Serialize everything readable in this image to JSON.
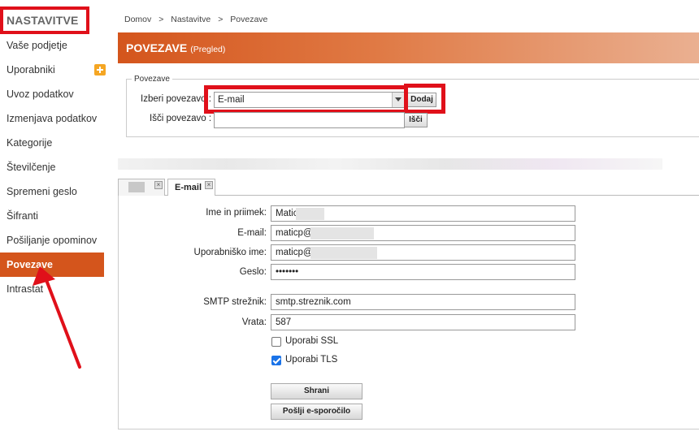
{
  "sidebar": {
    "title": "NASTAVITVE",
    "items": [
      {
        "label": "Vaše podjetje"
      },
      {
        "label": "Uporabniki"
      },
      {
        "label": "Uvoz podatkov"
      },
      {
        "label": "Izmenjava podatkov"
      },
      {
        "label": "Kategorije"
      },
      {
        "label": "Številčenje"
      },
      {
        "label": "Spremeni geslo"
      },
      {
        "label": "Šifranti"
      },
      {
        "label": "Pošiljanje opominov"
      },
      {
        "label": "Povezave"
      },
      {
        "label": "Intrastat"
      }
    ],
    "active_index": 9
  },
  "breadcrumb": {
    "items": [
      "Domov",
      ">",
      "Nastavitve",
      ">",
      "Povezave"
    ]
  },
  "header": {
    "title": "POVEZAVE",
    "subtitle": "(Pregled)"
  },
  "connections": {
    "legend": "Povezave",
    "select_label": "Izberi povezavo :",
    "select_value": "E-mail",
    "add_button": "Dodaj",
    "search_label": "Išči povezavo :",
    "search_value": "",
    "search_button": "Išči"
  },
  "tabs": [
    {
      "label": "",
      "close": "×"
    },
    {
      "label": "E-mail",
      "close": "×",
      "active": true
    }
  ],
  "form": {
    "name_label": "Ime in priimek:",
    "name_value": "Matic",
    "email_label": "E-mail:",
    "email_value": "maticp@",
    "username_label": "Uporabniško ime:",
    "username_value": "maticp@",
    "password_label": "Geslo:",
    "password_value": "•••••••",
    "smtp_label": "SMTP strežnik:",
    "smtp_value": "smtp.streznik.com",
    "port_label": "Vrata:",
    "port_value": "587",
    "ssl_label": "Uporabi SSL",
    "ssl_checked": false,
    "tls_label": "Uporabi TLS",
    "tls_checked": true,
    "save_button": "Shrani",
    "send_button": "Pošlji e-sporočilo"
  },
  "colors": {
    "accent": "#d4551c",
    "annotation": "#e0101a",
    "checkbox": "#1a73e8"
  }
}
